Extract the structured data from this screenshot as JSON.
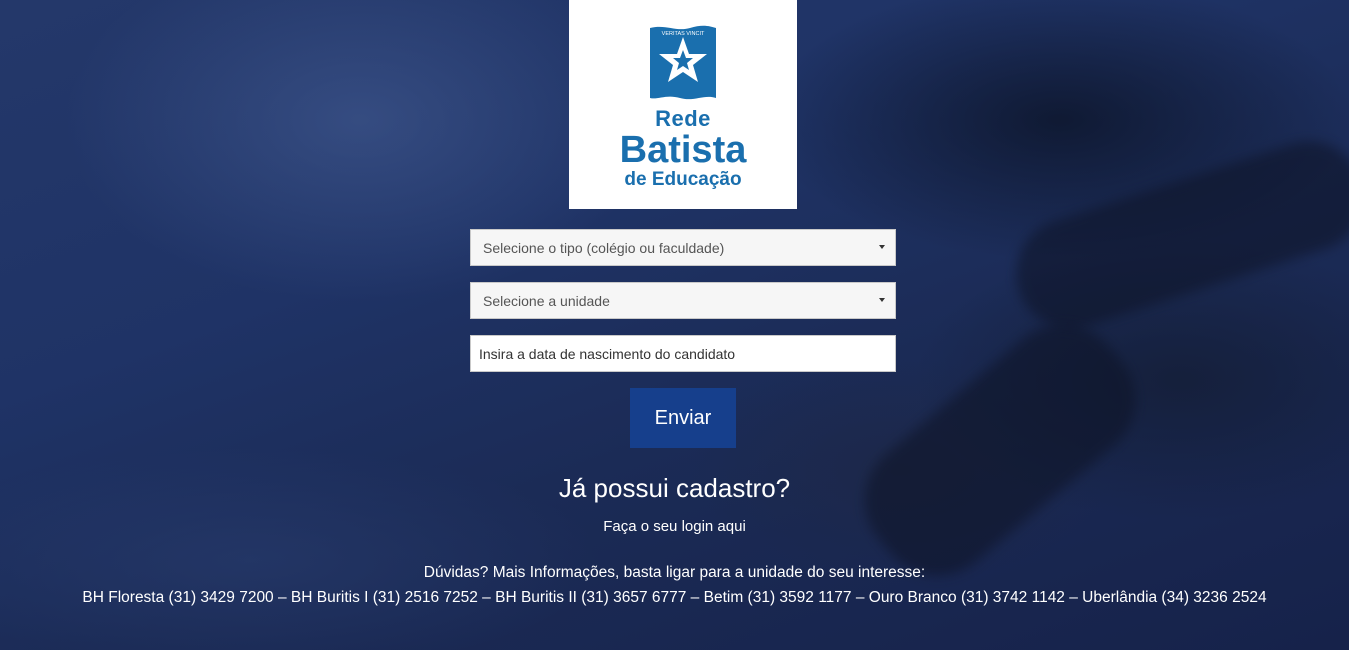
{
  "logo": {
    "line1": "Rede",
    "line2": "Batista",
    "line3": "de Educação",
    "motto": "VERITAS VINCIT"
  },
  "form": {
    "type_select": "Selecione o tipo (colégio ou faculdade)",
    "unit_select": "Selecione a unidade",
    "birthdate_placeholder": "Insira a data de nascimento do candidato",
    "submit_label": "Enviar"
  },
  "login": {
    "heading": "Já possui cadastro?",
    "link": "Faça o seu login aqui"
  },
  "footer": {
    "info": "Dúvidas? Mais Informações, basta ligar para a unidade do seu interesse:",
    "phones": "BH Floresta (31) 3429 7200 – BH Buritis I (31) 2516 7252 – BH Buritis II (31) 3657 6777 – Betim (31) 3592 1177 – Ouro Branco (31) 3742 1142 – Uberlândia (34) 3236 2524"
  },
  "colors": {
    "brand_blue": "#1a6fae",
    "button_blue": "#163f8c",
    "background": "#1c2c55"
  }
}
